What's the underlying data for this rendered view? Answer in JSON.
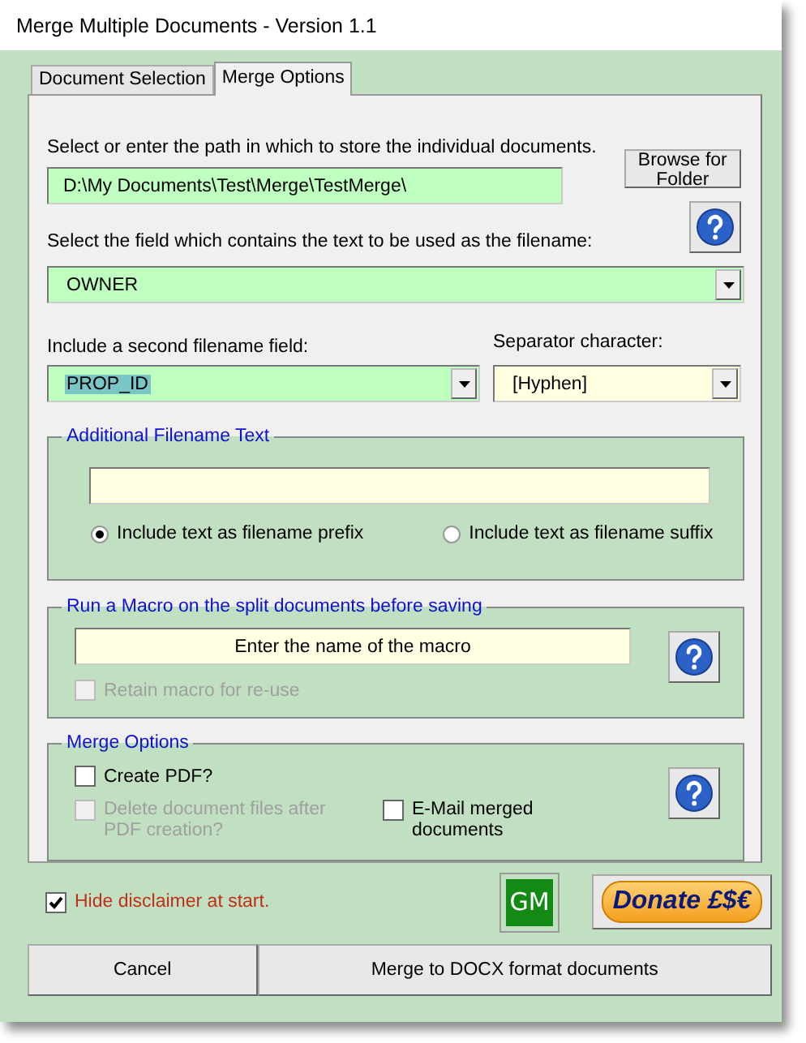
{
  "window": {
    "title": "Merge Multiple Documents - Version 1.1"
  },
  "tabs": [
    {
      "label": "Document Selection",
      "selected": false
    },
    {
      "label": "Merge Options",
      "selected": true
    }
  ],
  "path": {
    "label": "Select or enter the path in which to store the individual documents.",
    "value": "D:\\My Documents\\Test\\Merge\\TestMerge\\"
  },
  "browse_button": "Browse for Folder",
  "filename_field": {
    "label": "Select the field which contains the text to be used as the filename:",
    "value": "OWNER"
  },
  "second_field": {
    "label": "Include a second filename field:",
    "value": "PROP_ID",
    "text_selected": true
  },
  "separator": {
    "label": "Separator character:",
    "value": "[Hyphen]"
  },
  "additional_text": {
    "title": "Additional Filename Text",
    "options": [
      {
        "label": "Include text as filename prefix",
        "selected": true
      },
      {
        "label": "Include text as filename suffix",
        "selected": false
      }
    ]
  },
  "macro": {
    "title": "Run a Macro on the split documents before saving",
    "value": "Enter the name of the macro",
    "retain": {
      "label": "Retain macro for re-use",
      "checked": false,
      "disabled": true
    }
  },
  "merge_options": {
    "title": "Merge Options",
    "checks": [
      {
        "label": "Create PDF?",
        "checked": false,
        "disabled": false
      },
      {
        "label": "Delete document files after PDF creation?",
        "checked": false,
        "disabled": true
      },
      {
        "label": "E-Mail merged documents",
        "checked": false,
        "disabled": false
      }
    ]
  },
  "disclaimer": {
    "label": "Hide disclaimer at start.",
    "checked": true
  },
  "gm_button": "GM",
  "donate_button": "Donate £$€",
  "buttons": [
    "Cancel",
    "Merge to DOCX format documents"
  ]
}
